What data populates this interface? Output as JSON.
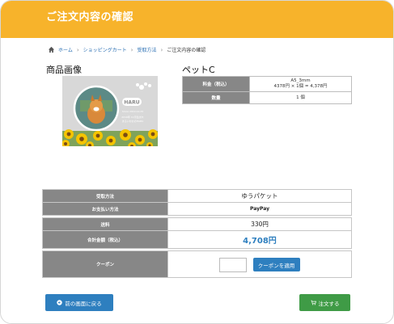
{
  "header": {
    "title": "ご注文内容の確認"
  },
  "breadcrumb": {
    "items": [
      "ホーム",
      "ショッピングカート",
      "受取方法",
      "ご注文内容の確認"
    ],
    "separator": "›"
  },
  "product": {
    "image_label": "商品画像",
    "name": "ペットC",
    "image_text": {
      "tag": "HARU",
      "line1": "Since 2019.12.25",
      "line2": "2019年 11月生まれ",
      "line3": "まるいかおのHARU"
    },
    "price_rows": [
      {
        "label": "料金（税込）",
        "value_line1": "A5_3mm",
        "value_line2": "4378円 × 1個 = 4,378円"
      },
      {
        "label": "数量",
        "value_line1": "1 個",
        "value_line2": ""
      }
    ]
  },
  "order": {
    "delivery_label": "受取方法",
    "delivery_value": "ゆうパケット",
    "payment_label": "お支払い方法",
    "payment_value": "PayPay",
    "shipping_label": "送料",
    "shipping_value": "330円",
    "total_label": "合計金額（税込）",
    "total_value": "4,708円",
    "coupon_label": "クーポン",
    "coupon_placeholder": "",
    "coupon_button": "クーポンを適用"
  },
  "actions": {
    "back_label": "前の画面に戻る",
    "order_label": "注文する"
  },
  "icons": {
    "home": "home-icon",
    "back": "arrow-left-circle-icon",
    "cart": "cart-icon"
  },
  "colors": {
    "header": "#f7b32b",
    "primary": "#2e7fbf",
    "success": "#3f9b46",
    "total": "#2e7fbf",
    "key_cell": "#878787"
  }
}
